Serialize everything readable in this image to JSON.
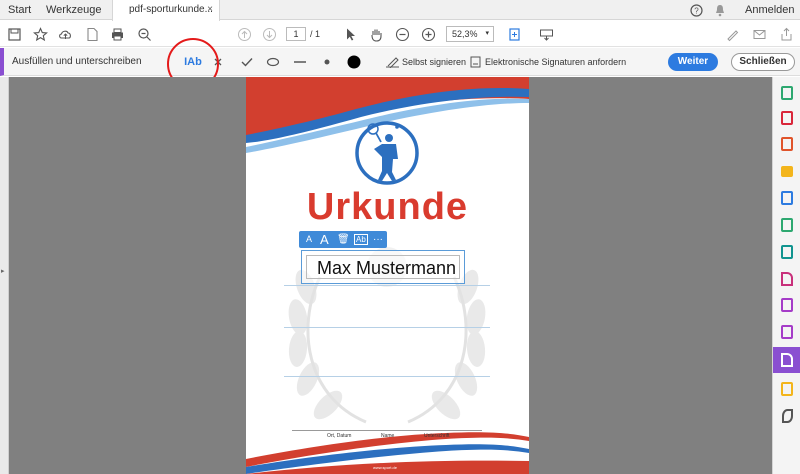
{
  "tabs": {
    "start": "Start",
    "tools": "Werkzeuge",
    "document": "pdf-sporturkunde...",
    "close": "×"
  },
  "account": {
    "help_icon": "help-icon",
    "bell_icon": "bell-icon",
    "signin": "Anmelden"
  },
  "toolbar": {
    "page_current": "1",
    "page_sep": "/ 1",
    "zoom": "52,3%"
  },
  "fill_sign": {
    "title": "Ausfüllen und unterschreiben",
    "text_tool": "IAb",
    "self_sign": "Selbst signieren",
    "request_sign": "Elektronische Signaturen anfordern",
    "continue": "Weiter",
    "close": "Schließen"
  },
  "certificate": {
    "heading": "Urkunde",
    "name_value": "Max Mustermann",
    "place_date": "Ort, Datum",
    "name_label": "Name",
    "signature_label": "Unterschrift",
    "footer": "www.sport.de"
  },
  "minibar": {
    "small_a": "A",
    "large_a": "A",
    "delete": "🗑",
    "field": "Ab",
    "more": "···"
  },
  "colors": {
    "accent": "#8a4fd1",
    "primary": "#2d7be0",
    "urkunde_red": "#d93b2e",
    "wave_blue": "#2c6fbf",
    "highlight": "#e41a1a"
  }
}
